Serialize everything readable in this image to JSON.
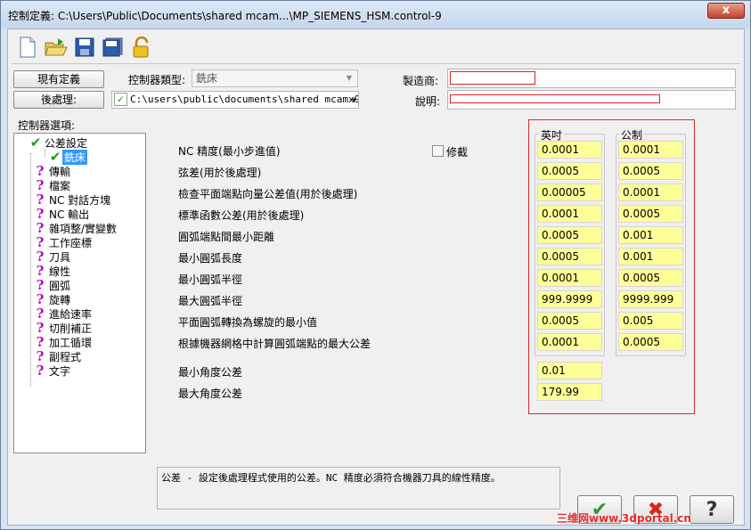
{
  "window": {
    "title": "控制定義: C:\\Users\\Public\\Documents\\shared  mcam...\\MP_SIEMENS_HSM.control-9",
    "close_label": "x"
  },
  "toolbar": [
    "new-file-icon",
    "open-folder-icon",
    "save-icon",
    "save-as-icon",
    "lock-icon"
  ],
  "header": {
    "current_def_button": "現有定義",
    "post_button": "後處理:",
    "controller_type_label": "控制器類型:",
    "controller_type_value": "銑床",
    "post_path": "C:\\users\\public\\documents\\shared mcamx9'",
    "manufacturer_label": "製造商:",
    "manufacturer_value": "",
    "description_label": "說明:",
    "description_value": ""
  },
  "tree": {
    "label": "控制器選項:",
    "items": [
      {
        "label": "公差設定",
        "icon": "check"
      },
      {
        "label": "銑床",
        "icon": "check"
      },
      {
        "label": "傳輸",
        "icon": "question"
      },
      {
        "label": "檔案",
        "icon": "question"
      },
      {
        "label": "NC 對話方塊",
        "icon": "question"
      },
      {
        "label": "NC 輸出",
        "icon": "question"
      },
      {
        "label": "雜項整/實變數",
        "icon": "question"
      },
      {
        "label": "工作座標",
        "icon": "question"
      },
      {
        "label": "刀具",
        "icon": "question"
      },
      {
        "label": "線性",
        "icon": "question"
      },
      {
        "label": "圓弧",
        "icon": "question"
      },
      {
        "label": "旋轉",
        "icon": "question"
      },
      {
        "label": "進給速率",
        "icon": "question"
      },
      {
        "label": "切削補正",
        "icon": "question"
      },
      {
        "label": "加工循環",
        "icon": "question"
      },
      {
        "label": "副程式",
        "icon": "question"
      },
      {
        "label": "文字",
        "icon": "question"
      }
    ]
  },
  "modify_label": "修截",
  "columns": {
    "inch": "英吋",
    "metric": "公制"
  },
  "rows": [
    {
      "label": "NC 精度(最小步進值)",
      "inch": "0.0001",
      "metric": "0.0001"
    },
    {
      "label": "弦差(用於後處理)",
      "inch": "0.0005",
      "metric": "0.0005"
    },
    {
      "label": "檢查平面端點向量公差值(用於後處理)",
      "inch": "0.00005",
      "metric": "0.0001"
    },
    {
      "label": "標準函數公差(用於後處理)",
      "inch": "0.0001",
      "metric": "0.0005"
    },
    {
      "label": "圓弧端點間最小距離",
      "inch": "0.0005",
      "metric": "0.001"
    },
    {
      "label": "最小圓弧長度",
      "inch": "0.0005",
      "metric": "0.001"
    },
    {
      "label": "最小圓弧半徑",
      "inch": "0.0001",
      "metric": "0.0005"
    },
    {
      "label": "最大圓弧半徑",
      "inch": "999.9999",
      "metric": "9999.999"
    },
    {
      "label": "平面圓弧轉換為螺旋的最小值",
      "inch": "0.0005",
      "metric": "0.005"
    },
    {
      "label": "根據機器網格中計算圓弧端點的最大公差",
      "inch": "0.0001",
      "metric": "0.0005"
    }
  ],
  "angle_rows": [
    {
      "label": "最小角度公差",
      "value": "0.01"
    },
    {
      "label": "最大角度公差",
      "value": "179.99"
    }
  ],
  "description_text": "公差 - 設定後處理程式使用的公差。NC 精度必須符合機器刀具的線性精度。",
  "buttons": {
    "ok_symbol": "✔",
    "cancel_symbol": "✖",
    "help_symbol": "?"
  },
  "watermark": "三维网www.3dportal.cn",
  "colors": {
    "field_yellow": "#ffff99",
    "highlight_red": "#d42c2c",
    "check_green": "#1f9a1f",
    "question_magenta": "#c000c8"
  }
}
